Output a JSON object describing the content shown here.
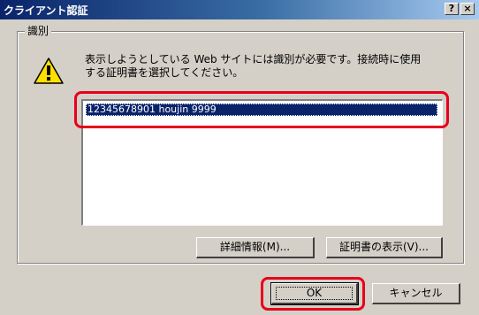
{
  "window": {
    "title": "クライアント認証",
    "help_button": "?",
    "close_button": "×"
  },
  "group": {
    "label": "識別",
    "message_line1": "表示しようとしている Web サイトには識別が必要です。接続時に使用",
    "message_line2": "する証明書を選択してください。"
  },
  "certificates": {
    "items": [
      "12345678901 houjin 9999"
    ],
    "selected_index": 0
  },
  "buttons": {
    "details_label": "詳細情報(M)...",
    "view_certificate_label": "証明書の表示(V)...",
    "ok_label": "OK",
    "cancel_label": "キャンセル"
  },
  "colors": {
    "dialog_face": "#d4d0c8",
    "selection": "#0a246a",
    "annotation_red": "#e8001c",
    "warning_yellow": "#ffe000"
  },
  "icons": {
    "warning": "warning-triangle-icon"
  }
}
